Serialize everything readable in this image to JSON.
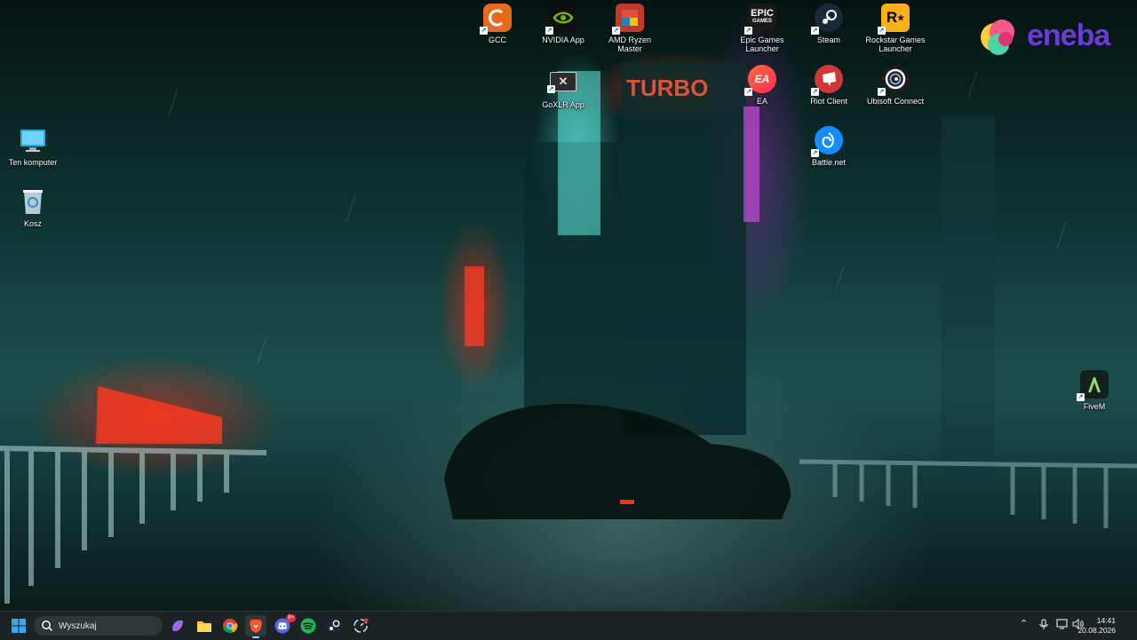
{
  "desktop": {
    "left_icons": [
      {
        "label": "Ten komputer",
        "icon": "monitor-icon"
      },
      {
        "label": "Kosz",
        "icon": "recycle-bin-icon"
      }
    ],
    "top_icons": [
      {
        "label": "GCC",
        "icon": "gcc-icon",
        "color": "#e86a1c"
      },
      {
        "label": "NVIDIA App",
        "icon": "nvidia-icon",
        "color": "#76b900"
      },
      {
        "label": "AMD Ryzen Master",
        "icon": "amd-ryzen-icon",
        "color": "#c0392b"
      },
      {
        "label": "Epic Games Launcher",
        "icon": "epic-games-icon",
        "color": "#1a1a1a"
      },
      {
        "label": "Steam",
        "icon": "steam-icon",
        "color": "#1b2838"
      },
      {
        "label": "Rockstar Games Launcher",
        "icon": "rockstar-icon",
        "color": "#fcaf17"
      },
      {
        "label": "GoXLR App",
        "icon": "goxlr-icon",
        "color": "#333333"
      },
      {
        "label": "EA",
        "icon": "ea-icon",
        "color": "#ff4747"
      },
      {
        "label": "Riot Client",
        "icon": "riot-icon",
        "color": "#d13639"
      },
      {
        "label": "Ubisoft Connect",
        "icon": "ubisoft-icon",
        "color": "#1d1d1d"
      },
      {
        "label": "Battle.net",
        "icon": "battlenet-icon",
        "color": "#148eff"
      },
      {
        "label": "FiveM",
        "icon": "fivem-icon",
        "color": "#1f2b22"
      }
    ],
    "logo": {
      "text": "eneba",
      "color": "#6c3bd6"
    }
  },
  "wallpaper_signs": [
    "TURBO"
  ],
  "taskbar": {
    "search_placeholder": "Wyszukaj",
    "discord_badge": "9+",
    "clock_time": "14:41",
    "clock_date": "20.08.2026",
    "pinned": [
      "windows-start-icon",
      "copilot-icon",
      "file-explorer-icon",
      "chrome-icon",
      "brave-icon",
      "discord-icon",
      "spotify-icon",
      "steam-taskbar-icon",
      "aura-icon"
    ]
  }
}
